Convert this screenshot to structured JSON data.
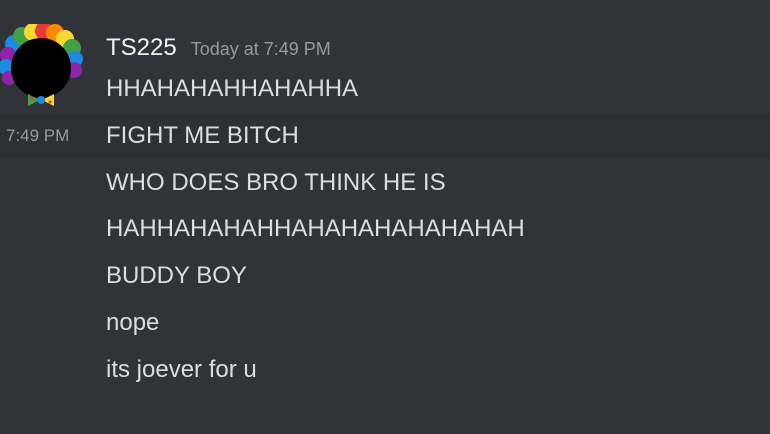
{
  "message": {
    "username": "TS225",
    "timestamp": "Today at 7:49 PM",
    "hover_time": "7:49 PM",
    "lines": [
      "HHAHAHAHHAHAHHA",
      "FIGHT ME BITCH",
      "WHO DOES BRO THINK HE IS",
      "HAHHAHAHAHHAHAHAHAHAHAHAH",
      "BUDDY BOY",
      "nope",
      "its joever for u"
    ]
  },
  "avatar": {
    "icon": "rainbow-clown-wig-avatar",
    "colors": [
      "#e53935",
      "#fb8c00",
      "#fdd835",
      "#43a047",
      "#1e88e5",
      "#8e24aa"
    ]
  },
  "theme": {
    "background": "#313338",
    "hover_background": "#2e3035",
    "text": "#dbdee1",
    "muted": "#949ba4"
  }
}
